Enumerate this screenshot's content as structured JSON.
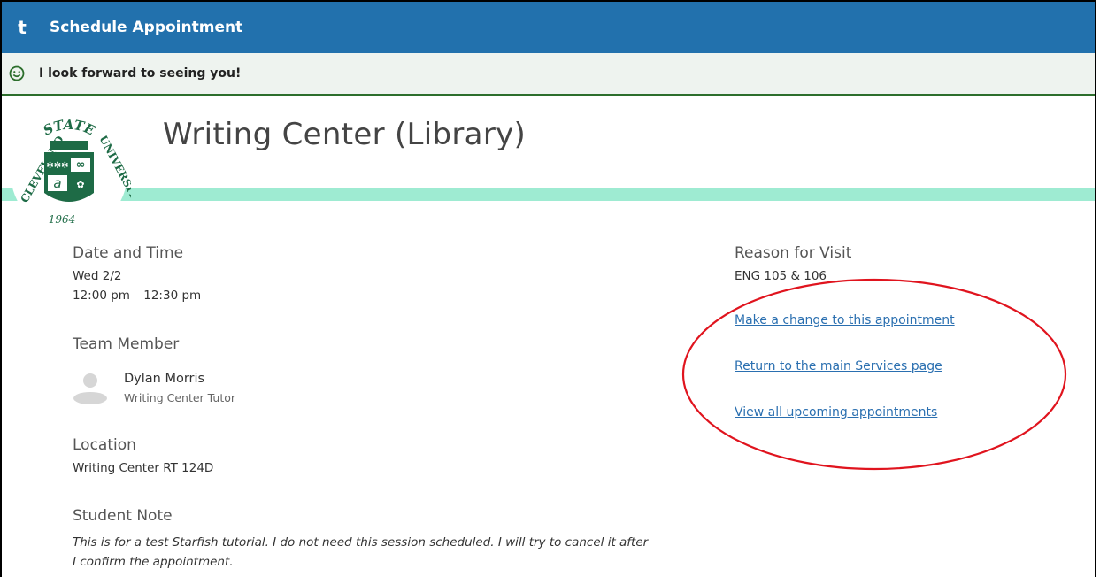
{
  "header": {
    "logo_glyph": "t",
    "title": "Schedule Appointment"
  },
  "banner": {
    "icon": "smiley-icon",
    "message": "I look forward to seeing you!"
  },
  "seal": {
    "top_text": "STATE",
    "left_text": "CLEVELAND",
    "right_text": "UNIVERSITY",
    "year": "1964"
  },
  "page": {
    "title": "Writing Center (Library)"
  },
  "date_time": {
    "heading": "Date and Time",
    "day": "Wed 2/2",
    "time": "12:00 pm – 12:30 pm"
  },
  "team_member": {
    "heading": "Team Member",
    "name": "Dylan Morris",
    "role": "Writing Center Tutor"
  },
  "location": {
    "heading": "Location",
    "value": "Writing Center RT 124D"
  },
  "student_note": {
    "heading": "Student Note",
    "line1": "This is for a test Starfish tutorial. I do not need this session scheduled. I will try to cancel it after",
    "line2": "I confirm the appointment."
  },
  "reason": {
    "heading": "Reason for Visit",
    "value": "ENG 105 & 106"
  },
  "links": {
    "change": "Make a change to this appointment",
    "services": "Return to the main Services page",
    "upcoming": "View all upcoming appointments"
  },
  "colors": {
    "header_bg": "#2271ad",
    "accent_bar": "#9eebd2",
    "seal_green": "#1e6b46",
    "annotation": "#e0141e"
  }
}
